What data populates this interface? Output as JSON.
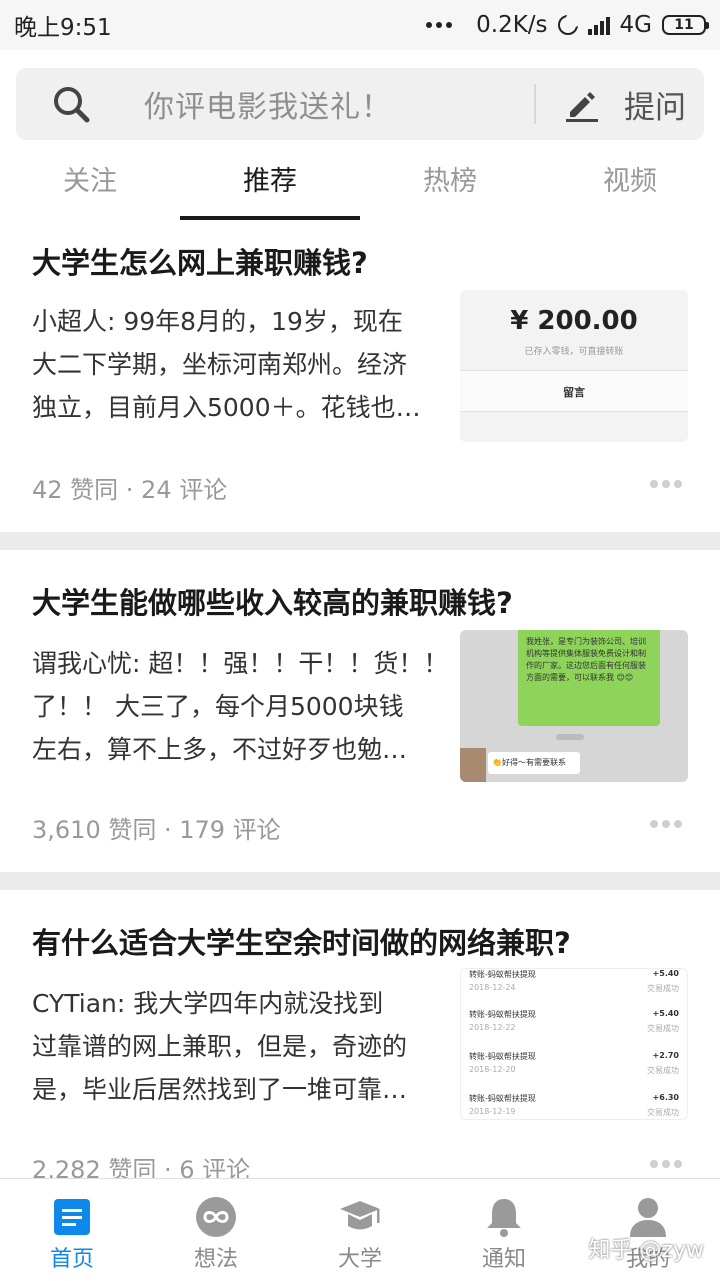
{
  "status_bar": {
    "time": "晚上9:51",
    "speed": "0.2K/s",
    "network": "4G",
    "battery": "11"
  },
  "search": {
    "placeholder": "你评电影我送礼！",
    "ask_label": "提问"
  },
  "tabs": [
    {
      "label": "关注",
      "active": false
    },
    {
      "label": "推荐",
      "active": true
    },
    {
      "label": "热榜",
      "active": false
    },
    {
      "label": "视频",
      "active": false
    }
  ],
  "feed": [
    {
      "title": "大学生怎么网上兼职赚钱?",
      "excerpt_lines": [
        "小超人: 99年8月的，19岁，现在",
        "大二下学期，坐标河南郑州。经济",
        "独立，目前月入5000＋。花钱也…"
      ],
      "meta": "42 赞同 · 24 评论",
      "thumb": {
        "amount": "¥ 200.00",
        "sub": "已存入零钱，可直接转账",
        "button": "留言"
      }
    },
    {
      "title": "大学生能做哪些收入较高的兼职赚钱?",
      "excerpt_lines": [
        "谓我心忧: 超！！强！！干！！货！！",
        "了！！ 大三了，每个月5000块钱",
        "左右，算不上多，不过好歹也勉…"
      ],
      "meta": "3,610 赞同 · 179 评论",
      "thumb": {
        "bubble": "我姓张，是专门为装饰公司、培训机构等提供集体服装免费设计和制作的厂家。这边您后面有任何服装方面的需要，可以联系我 😊😊",
        "reply": "👏好得～有需要联系"
      }
    },
    {
      "title": "有什么适合大学生空余时间做的网络兼职?",
      "excerpt_lines": [
        "CYTian: 我大学四年内就没找到",
        "过靠谱的网上兼职，但是，奇迹的",
        "是，毕业后居然找到了一堆可靠…"
      ],
      "meta": "2,282 赞同 · 6 评论",
      "thumb": {
        "rows": [
          {
            "name": "转账-蚂蚁帮扶提现",
            "date": "2018-12-24",
            "amount": "+5.40",
            "status": "交易成功"
          },
          {
            "name": "转账-蚂蚁帮扶提现",
            "date": "2018-12-22",
            "amount": "+5.40",
            "status": "交易成功"
          },
          {
            "name": "转账-蚂蚁帮扶提现",
            "date": "2018-12-20",
            "amount": "+2.70",
            "status": "交易成功"
          },
          {
            "name": "转账-蚂蚁帮扶提现",
            "date": "2018-12-19",
            "amount": "+6.30",
            "status": "交易成功"
          }
        ]
      }
    }
  ],
  "bottom_nav": [
    {
      "label": "首页",
      "icon": "home-list-icon",
      "active": true
    },
    {
      "label": "想法",
      "icon": "infinity-icon",
      "active": false
    },
    {
      "label": "大学",
      "icon": "graduation-cap-icon",
      "active": false
    },
    {
      "label": "通知",
      "icon": "bell-icon",
      "active": false
    },
    {
      "label": "我的",
      "icon": "person-icon",
      "active": false
    }
  ],
  "watermark": "知乎 @zyw",
  "colors": {
    "accent": "#0f88eb",
    "text": "#1a1a1a",
    "muted": "#999999"
  }
}
